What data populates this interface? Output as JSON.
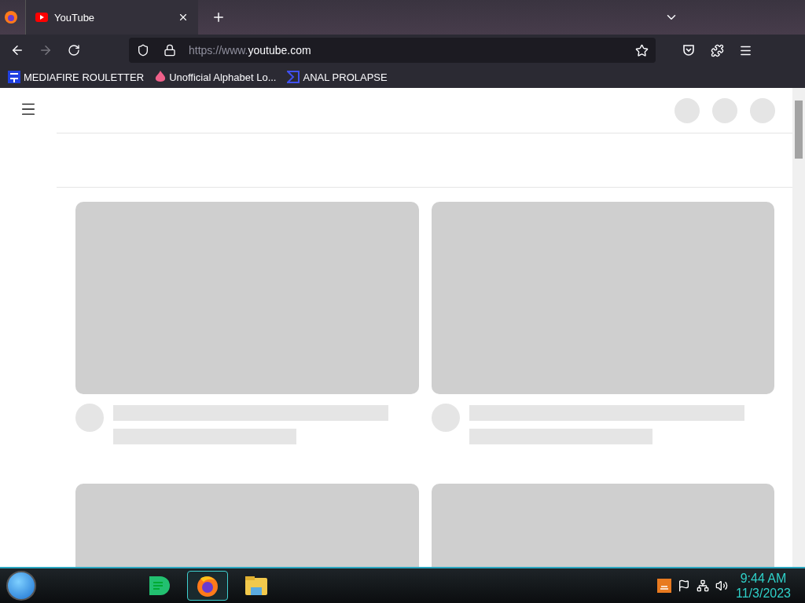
{
  "tabs": [
    {
      "title": "YouTube",
      "selected": true
    }
  ],
  "address_bar": {
    "scheme": "https://www.",
    "domain": "youtube.com"
  },
  "bookmarks": [
    {
      "label": "MEDIAFIRE ROULETTER",
      "kind": "mf"
    },
    {
      "label": "Unofficial Alphabet Lo...",
      "kind": "flame"
    },
    {
      "label": "ANAL PROLAPSE",
      "kind": "sigma"
    }
  ],
  "feed": [
    {
      "kind": "skeleton"
    },
    {
      "kind": "skeleton"
    },
    {
      "kind": "cut"
    },
    {
      "kind": "cut"
    }
  ],
  "taskbar": {
    "apps": [
      {
        "kind": "notes",
        "selected": false
      },
      {
        "kind": "firefox",
        "selected": true
      },
      {
        "kind": "explorer",
        "selected": false
      }
    ],
    "time": "9:44 AM",
    "date": "11/3/2023"
  }
}
